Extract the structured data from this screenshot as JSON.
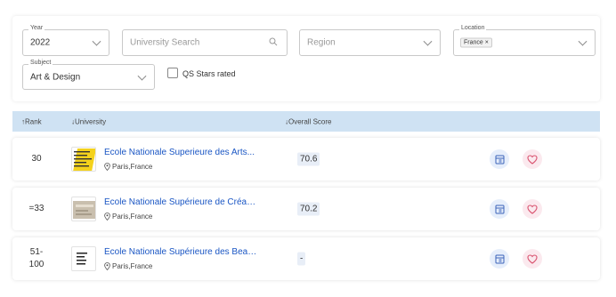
{
  "filters": {
    "year": {
      "label": "Year",
      "value": "2022"
    },
    "search": {
      "placeholder": "University Search"
    },
    "region": {
      "placeholder": "Region"
    },
    "location": {
      "label": "Location",
      "chip": "France ×"
    },
    "subject": {
      "label": "Subject",
      "value": "Art & Design"
    },
    "qs_stars": {
      "label": "QS Stars rated"
    }
  },
  "table": {
    "columns": {
      "rank": "↑Rank",
      "university": "↓University",
      "score": "↓Overall Score"
    },
    "rows": [
      {
        "rank": "30",
        "name": "Ecole Nationale Superieure des Arts...",
        "location": "Paris,France",
        "score": "70.6"
      },
      {
        "rank": "=33",
        "name": "École Nationale Supérieure de Créatio...",
        "location": "Paris,France",
        "score": "70.2"
      },
      {
        "rank": "51-\n100",
        "name": "École Nationale Supérieure des Beaux...",
        "location": "Paris,France",
        "score": "-"
      }
    ]
  },
  "colors": {
    "link": "#1a56c4",
    "header_bg": "#cfe2f3",
    "compare_bg": "#e6eefb",
    "fav_bg": "#fbe9ee",
    "fav_icon": "#d9536f",
    "compare_icon": "#3a63b8"
  },
  "icons": {
    "search": "search-icon",
    "compare": "compare-icon",
    "favourite": "heart-icon",
    "location": "location-pin-icon"
  }
}
